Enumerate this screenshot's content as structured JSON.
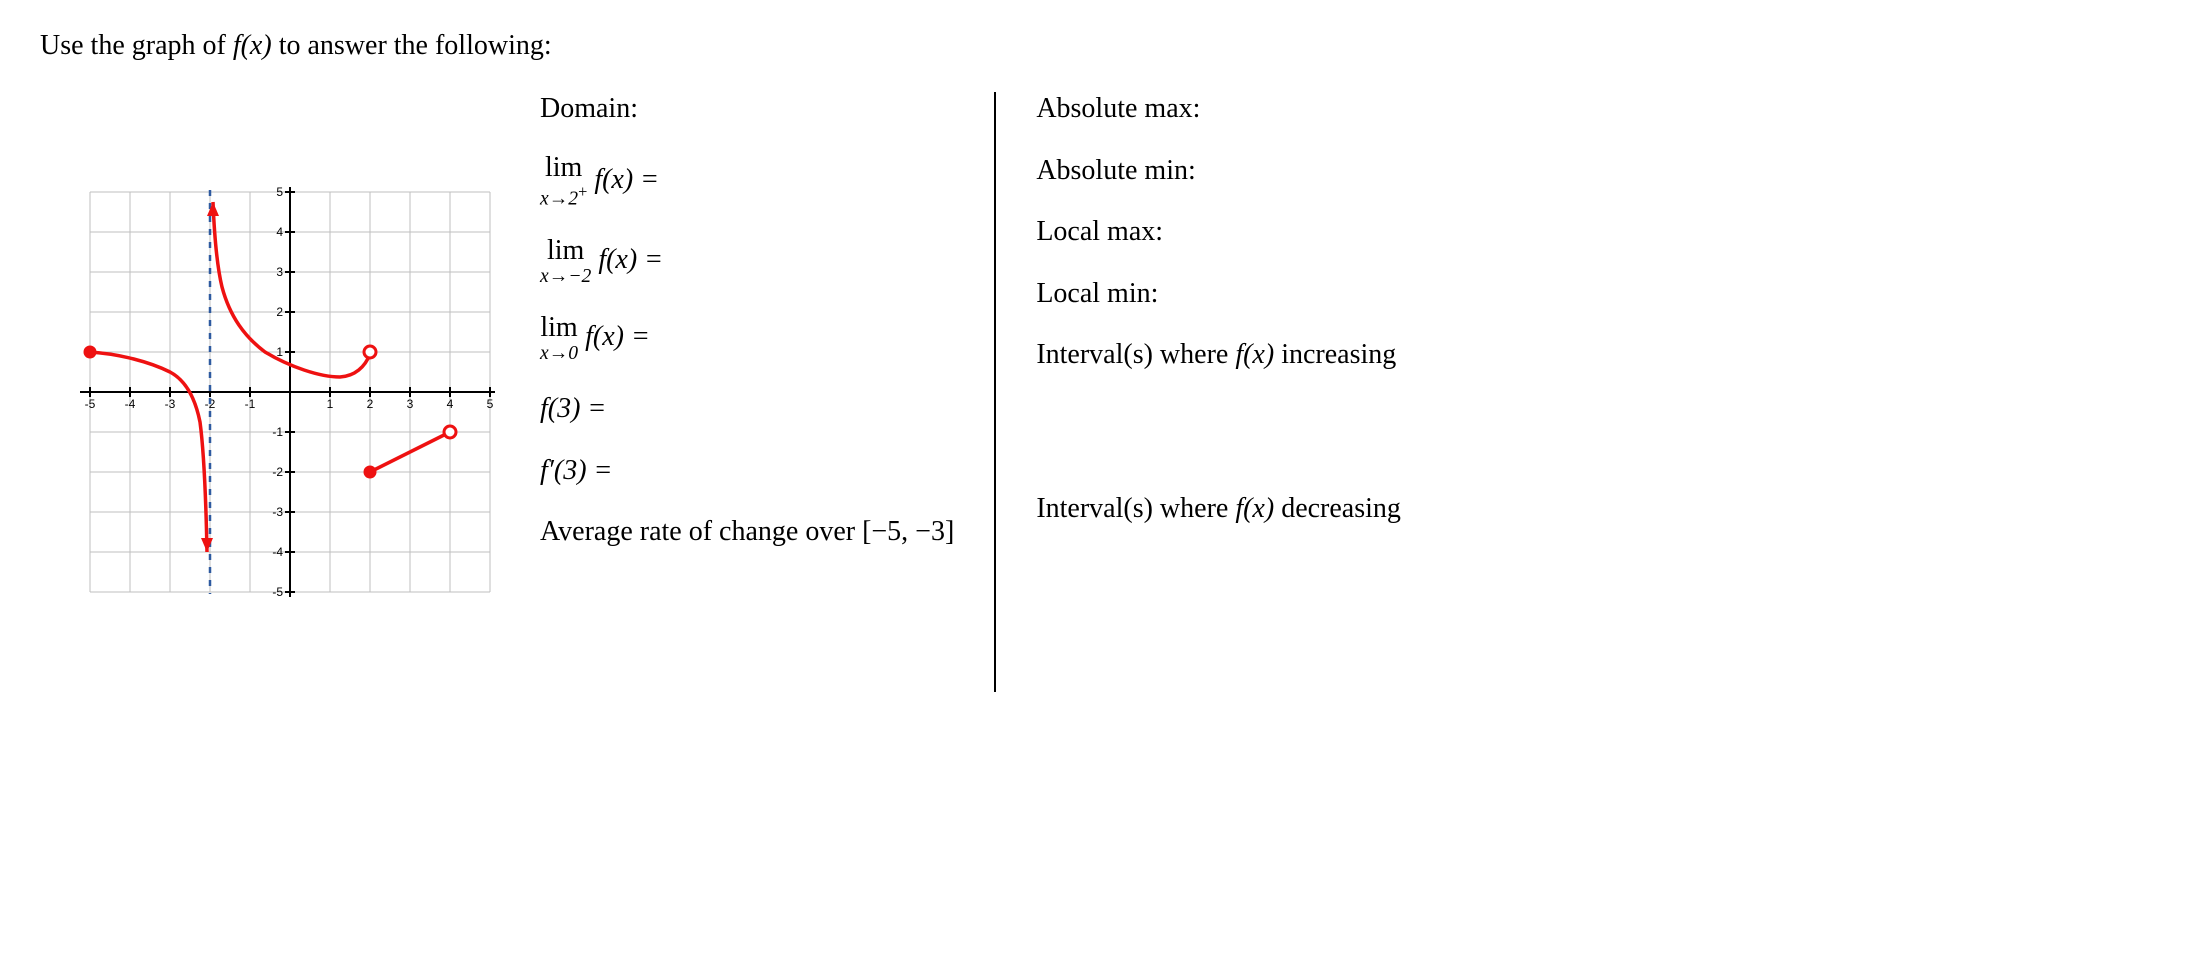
{
  "prompt_prefix": "Use the graph of ",
  "prompt_func": "f(x)",
  "prompt_suffix": " to answer the following:",
  "mid": {
    "domain_label": "Domain:",
    "lim1_top": "lim",
    "lim1_bot_pre": "x→2",
    "lim1_bot_sup": "+",
    "lim1_fx": " f(x) =",
    "lim2_top": "lim",
    "lim2_bot": "x→−2",
    "lim2_fx": " f(x) =",
    "lim3_top": "lim",
    "lim3_bot": "x→0",
    "lim3_fx": " f(x) =",
    "f3_label": "f(3) =",
    "fprime3_label": "f′(3) =",
    "avg_rate_label": "Average rate of change over [−5, −3]"
  },
  "right": {
    "abs_max": "Absolute max:",
    "abs_min": "Absolute min:",
    "local_max": "Local max:",
    "local_min": "Local min:",
    "inc_prefix": "Interval(s) where ",
    "inc_func": "f(x)",
    "inc_suffix": " increasing",
    "dec_prefix": "Interval(s) where ",
    "dec_func": "f(x)",
    "dec_suffix": " decreasing"
  },
  "chart_data": {
    "type": "line",
    "title": "",
    "xlabel": "",
    "ylabel": "",
    "xlim": [
      -5,
      5
    ],
    "ylim": [
      -5,
      5
    ],
    "x_ticks": [
      -5,
      -4,
      -3,
      -2,
      -1,
      1,
      2,
      3,
      4,
      5
    ],
    "y_ticks": [
      -5,
      -4,
      -3,
      -2,
      -1,
      1,
      2,
      3,
      4,
      5
    ],
    "grid": true,
    "asymptotes": [
      {
        "orientation": "vertical",
        "x": -2,
        "style": "dashed",
        "color": "#2e5aa0"
      }
    ],
    "pieces": [
      {
        "name": "piece1",
        "domain": [
          -5,
          -2
        ],
        "left_endpoint": {
          "x": -5,
          "y": 1,
          "open": false
        },
        "right_behavior": "asymptote_minus_infinity",
        "sample_points": [
          {
            "x": -5,
            "y": 1.0
          },
          {
            "x": -4,
            "y": 0.9
          },
          {
            "x": -3,
            "y": 0.5
          },
          {
            "x": -2.5,
            "y": -0.5
          },
          {
            "x": -2.2,
            "y": -2.0
          },
          {
            "x": -2.05,
            "y": -4.0
          }
        ]
      },
      {
        "name": "piece2",
        "domain": [
          -2,
          2
        ],
        "left_behavior": "asymptote_plus_infinity",
        "right_endpoint": {
          "x": 2,
          "y": 1,
          "open": true
        },
        "sample_points": [
          {
            "x": -1.95,
            "y": 5.0
          },
          {
            "x": -1.8,
            "y": 4.0
          },
          {
            "x": -1.5,
            "y": 2.5
          },
          {
            "x": -1.0,
            "y": 1.4
          },
          {
            "x": 0.0,
            "y": 0.7
          },
          {
            "x": 1.0,
            "y": 0.35
          },
          {
            "x": 1.5,
            "y": 0.5
          },
          {
            "x": 2.0,
            "y": 1.0
          }
        ]
      },
      {
        "name": "piece3",
        "domain": [
          2,
          4
        ],
        "left_endpoint": {
          "x": 2,
          "y": -2,
          "open": false
        },
        "right_endpoint": {
          "x": 4,
          "y": -1,
          "open": true
        },
        "sample_points": [
          {
            "x": 2.0,
            "y": -2.0
          },
          {
            "x": 3.0,
            "y": -1.5
          },
          {
            "x": 4.0,
            "y": -1.0
          }
        ]
      }
    ]
  }
}
